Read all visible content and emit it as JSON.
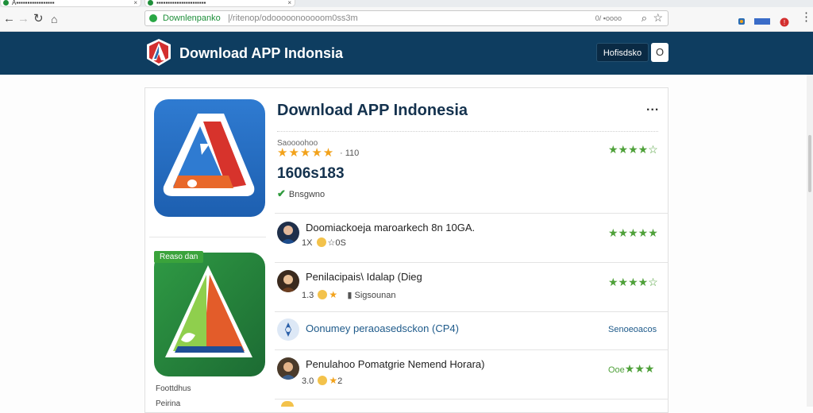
{
  "browser": {
    "tabs": [
      {
        "label": "A▪▪▪▪▪▪▪▪▪▪▪▪▪▪▪▪▪"
      },
      {
        "label": "▪▪▪▪▪▪▪▪▪▪▪▪▪▪▪▪▪▪▪▪▪▪"
      }
    ],
    "url_host": "Downlenpanko",
    "url_path": "|/ritenop/odooooonooooom0ss3m",
    "url_right": "0/ ▪oooo"
  },
  "header": {
    "brand": "Download APP Indonsia",
    "button_label": "Hofisdsko",
    "o_button": "O"
  },
  "app": {
    "title": "Download APP Indonesia",
    "menu": "...",
    "sublabel": "Saoooohoo",
    "rating_text": "· 110",
    "count": "1606s183",
    "verified": "Bnsgwno",
    "stars": "★★★★★",
    "green_stars": "★★★★☆"
  },
  "left": {
    "badge": "Reaso dan",
    "label1": "Foottdhus",
    "label2": "Peirina"
  },
  "rows": [
    {
      "title": "Doomiackoeja maroarkech 8n 10GA.",
      "meta_num": "1X",
      "meta_extra": "☆0S",
      "stars": "★★★★★"
    },
    {
      "title": "Penilacipais\\ Idalap (Dieg",
      "meta_num": "1.3",
      "meta_star": "★",
      "meta_extra": "Sigsounan",
      "stars": "★★★★☆"
    },
    {
      "title": "Oonumey peraoasedsckon (CP4)",
      "right": "Senoeoacos"
    },
    {
      "title": "Penulahoo Pomatgrie Nemend Horara)",
      "meta_num": "3.0",
      "meta_extra": "2",
      "left_text": "Ooe",
      "stars": "★★★"
    }
  ]
}
